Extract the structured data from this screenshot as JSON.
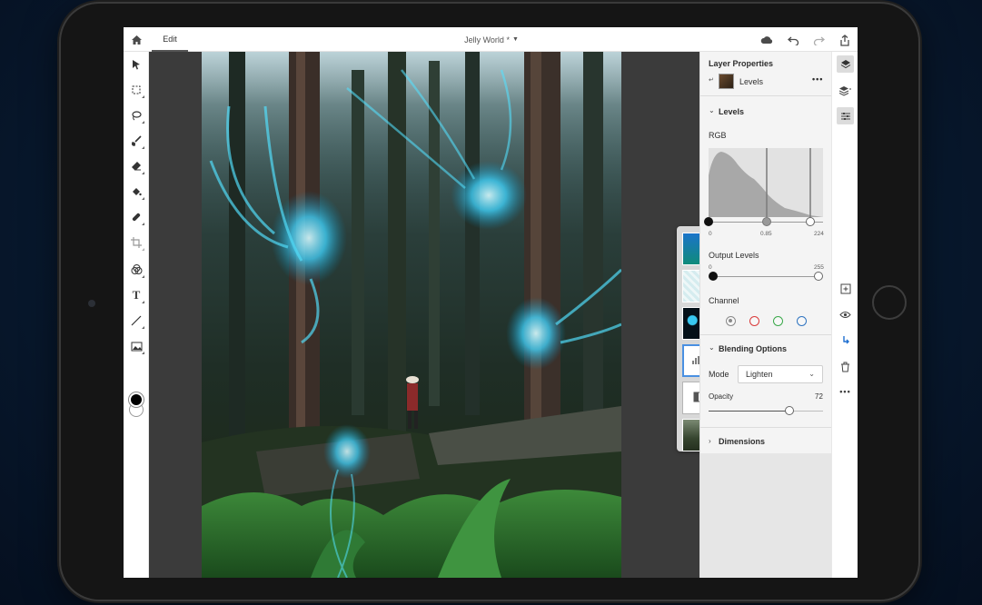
{
  "app": {
    "edit_tab": "Edit",
    "doc_title": "Jelly World *"
  },
  "icons": {
    "home": "home-icon",
    "cloud": "cloud-icon",
    "undo": "undo-icon",
    "redo": "redo-icon",
    "share": "share-icon"
  },
  "panel": {
    "title": "Layer Properties",
    "layer_name": "Levels",
    "levels_section": "Levels",
    "rgb_label": "RGB",
    "input_ticks": [
      "0",
      "0.85",
      "224"
    ],
    "input_values": {
      "black": 0,
      "gamma": 0.85,
      "white": 224
    },
    "output_label": "Output Levels",
    "output_ticks": [
      "0",
      "255"
    ],
    "channel_label": "Channel",
    "channel_colors": [
      "#8a8a8a",
      "#d93a3a",
      "#3aa84a",
      "#2f74c0"
    ],
    "blending_section": "Blending Options",
    "mode_label": "Mode",
    "mode_value": "Lighten",
    "opacity_label": "Opacity",
    "opacity_value": "72",
    "dimensions_section": "Dimensions"
  },
  "colors": {
    "accent": "#4a90e2",
    "jelly": "#39d4ff"
  }
}
